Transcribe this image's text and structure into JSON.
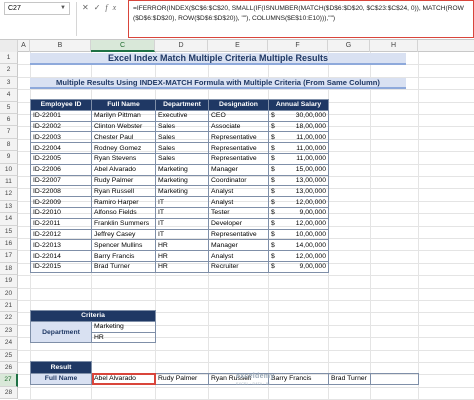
{
  "name_box": {
    "value": "C27"
  },
  "formula_bar": {
    "formula": "=IFERROR(INDEX($C$6:$C$20, SMALL(IF(ISNUMBER(MATCH($D$6:$D$20, $C$23:$C$24, 0)), MATCH(ROW($D$6:$D$20), ROW($D$6:$D$20)), \"\"), COLUMNS($E$10:E10))),\"\")"
  },
  "columns": [
    "A",
    "B",
    "C",
    "D",
    "E",
    "F",
    "G",
    "H"
  ],
  "selected_column": "C",
  "rows": [
    "1",
    "2",
    "3",
    "4",
    "5",
    "6",
    "7",
    "8",
    "9",
    "10",
    "11",
    "12",
    "13",
    "14",
    "15",
    "16",
    "17",
    "18",
    "19",
    "20",
    "21",
    "22",
    "23",
    "24",
    "25",
    "26",
    "27",
    "28"
  ],
  "selected_row": "27",
  "title": "Excel Index Match Multiple Criteria Multiple Results",
  "subtitle": "Multiple Results Using  INDEX-MATCH Formula with Multiple Criteria (From Same Column)",
  "main_table": {
    "headers": [
      "Employee ID",
      "Full Name",
      "Department",
      "Designation",
      "Annual Salary"
    ],
    "currency_symbol": "$",
    "rows": [
      [
        "ID-22001",
        "Marilyn Pittman",
        "Executive",
        "CEO",
        "30,00,000"
      ],
      [
        "ID-22002",
        "Clinton Webster",
        "Sales",
        "Associate",
        "18,00,000"
      ],
      [
        "ID-22003",
        "Chester Paul",
        "Sales",
        "Representative",
        "11,00,000"
      ],
      [
        "ID-22004",
        "Rodney Gomez",
        "Sales",
        "Representative",
        "11,00,000"
      ],
      [
        "ID-22005",
        "Ryan Stevens",
        "Sales",
        "Representative",
        "11,00,000"
      ],
      [
        "ID-22006",
        "Abel Alvarado",
        "Marketing",
        "Manager",
        "15,00,000"
      ],
      [
        "ID-22007",
        "Rudy Palmer",
        "Marketing",
        "Coordinator",
        "13,00,000"
      ],
      [
        "ID-22008",
        "Ryan Russell",
        "Marketing",
        "Analyst",
        "13,00,000"
      ],
      [
        "ID-22009",
        "Ramiro Harper",
        "IT",
        "Analyst",
        "12,00,000"
      ],
      [
        "ID-22010",
        "Alfonso Fields",
        "IT",
        "Tester",
        "9,00,000"
      ],
      [
        "ID-22011",
        "Franklin Summers",
        "IT",
        "Developer",
        "12,00,000"
      ],
      [
        "ID-22012",
        "Jeffrey Casey",
        "IT",
        "Representative",
        "10,00,000"
      ],
      [
        "ID-22013",
        "Spencer Mullins",
        "HR",
        "Manager",
        "14,00,000"
      ],
      [
        "ID-22014",
        "Barry Francis",
        "HR",
        "Analyst",
        "12,00,000"
      ],
      [
        "ID-22015",
        "Brad Turner",
        "HR",
        "Recruiter",
        "9,00,000"
      ]
    ]
  },
  "criteria": {
    "header": "Criteria",
    "label": "Department",
    "values": [
      "Marketing",
      "HR"
    ]
  },
  "result": {
    "header": "Result",
    "label": "Full Name",
    "values": [
      "Abel Alvarado",
      "Rudy Palmer",
      "Ryan Russell",
      "Barry Francis",
      "Brad Turner",
      ""
    ]
  },
  "watermark": {
    "brand": "exceldemy",
    "tagline": "EXCEL · DATA · BI"
  },
  "colors": {
    "header_navy": "#1f3864",
    "banner_blue": "#d9e1f2",
    "selection_red": "#d9453b",
    "excel_green": "#1e7145"
  }
}
